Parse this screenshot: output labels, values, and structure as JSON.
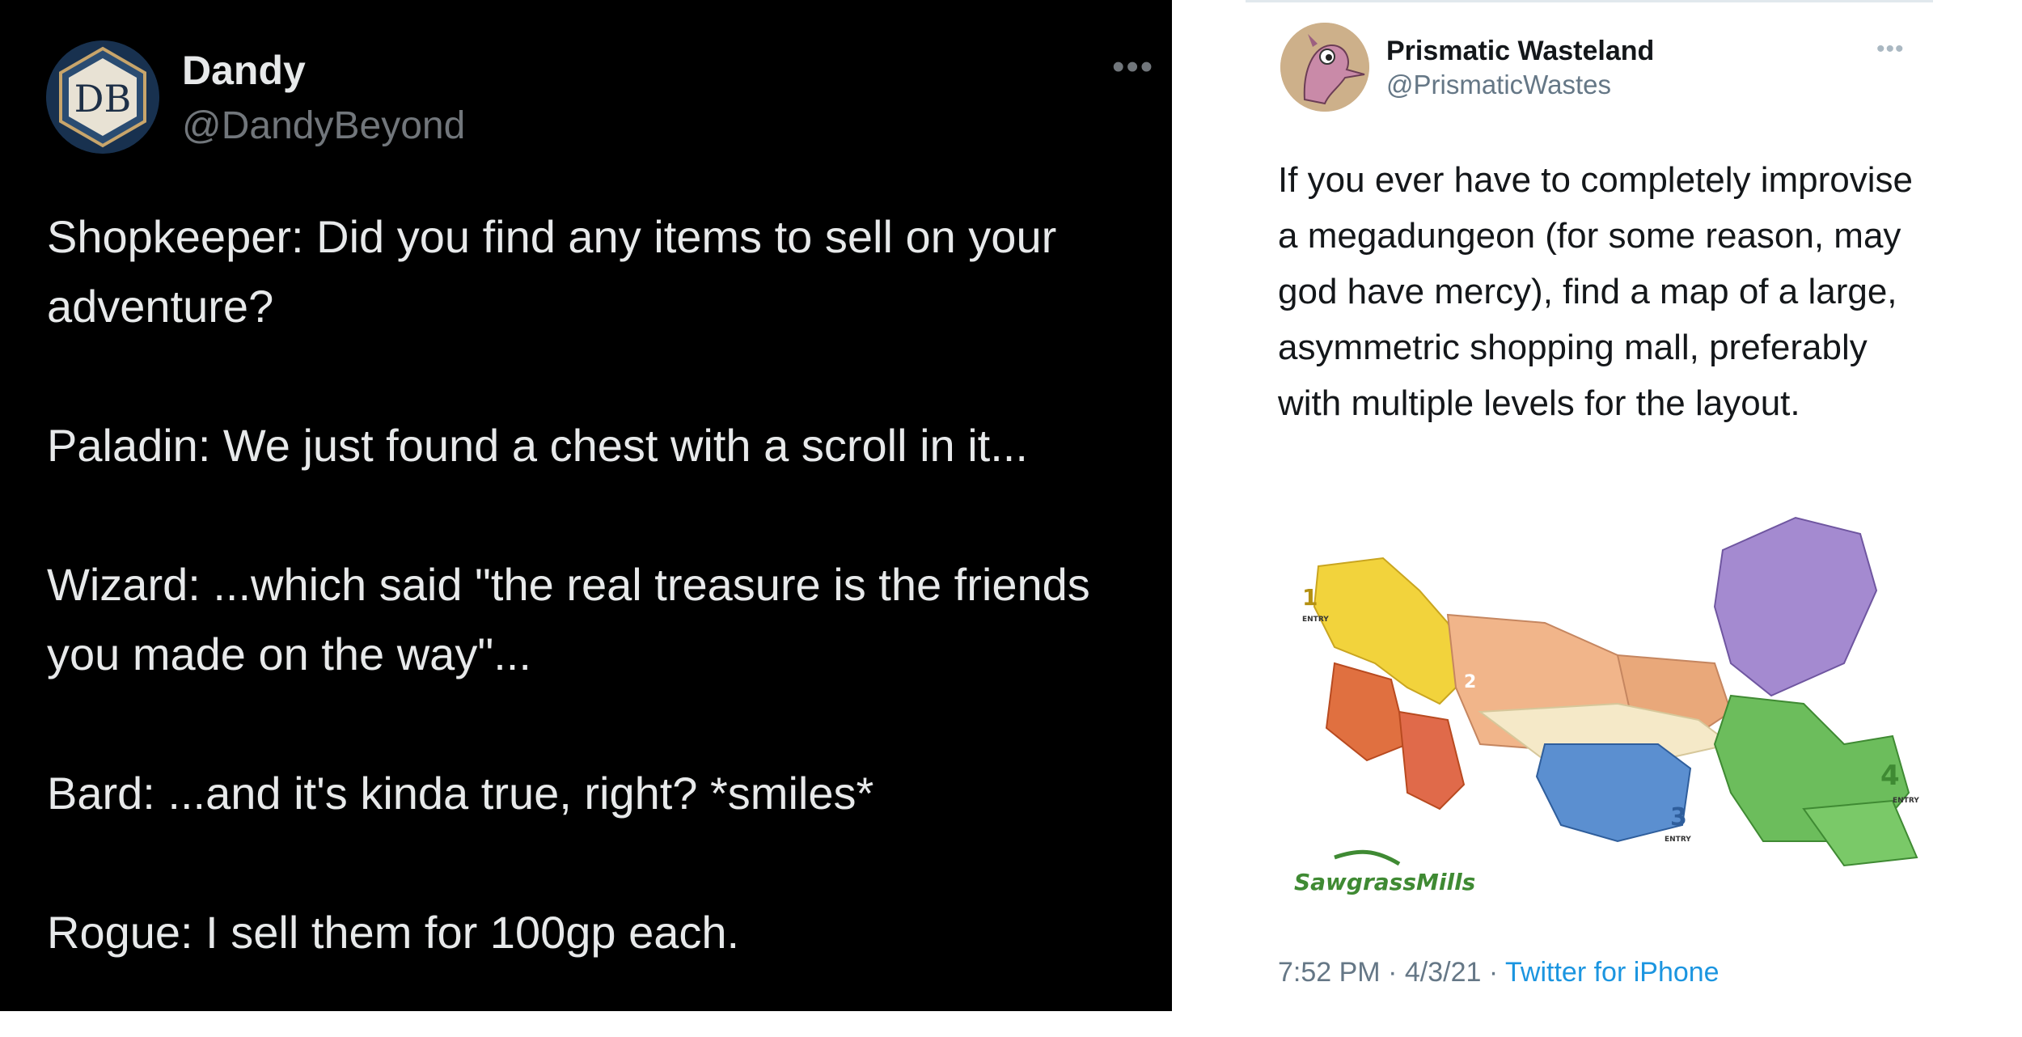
{
  "left_tweet": {
    "author_name": "Dandy",
    "author_handle": "@DandyBeyond",
    "avatar_text": "DB",
    "more_label": "•••",
    "lines": [
      "Shopkeeper: Did you find any items to sell on your adventure?",
      "Paladin: We just found a chest with a scroll in it...",
      "Wizard: ...which said \"the real treasure is the friends you made on the way\"...",
      "Bard: ...and it's kinda true, right? *smiles*",
      "Rogue: I sell them for 100gp each."
    ]
  },
  "right_tweet": {
    "author_name": "Prismatic Wasteland",
    "author_handle": "@PrismaticWastes",
    "more_label": "•••",
    "text": "If you ever have to completely improvise a megadungeon (for some reason, may god have mercy), find a map of a large, asymmetric shopping mall, preferably with multiple levels for the layout.",
    "map": {
      "logo_text": "SawgrassMills",
      "entry_numbers": [
        "1",
        "2",
        "3",
        "4"
      ],
      "entry_label": "ENTRY"
    },
    "time": "7:52 PM",
    "separator": "·",
    "date": "4/3/21",
    "source": "Twitter for iPhone"
  },
  "colors": {
    "dark_bg": "#000000",
    "dark_text": "#e7e9ea",
    "dark_secondary": "#71767b",
    "light_text": "#14171a",
    "light_secondary": "#657786",
    "link": "#1b95e0"
  }
}
